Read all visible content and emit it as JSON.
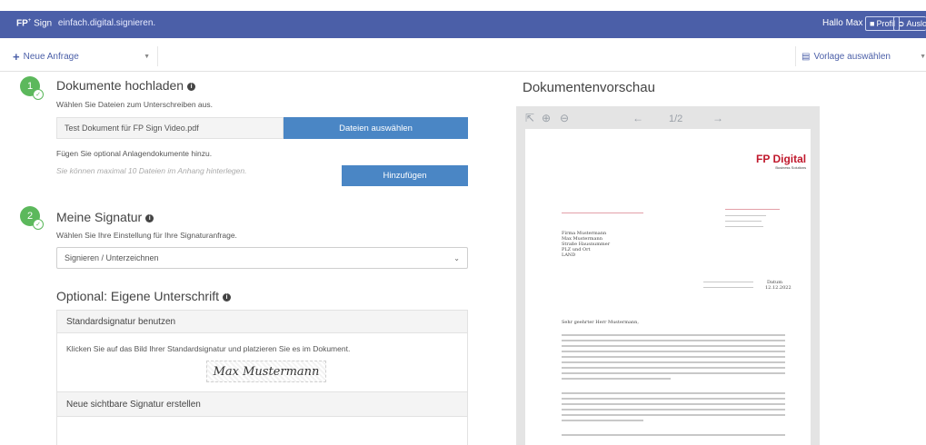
{
  "header": {
    "brand": "FP",
    "brand_suffix": "Sign",
    "tagline": "einfach.digital.signieren.",
    "greeting": "Hallo Max",
    "profile_label": "Profil",
    "logout_label": "Ausloggen"
  },
  "toolbar": {
    "new_request_label": "Neue Anfrage",
    "template_label": "Vorlage auswählen"
  },
  "step1": {
    "number": "1",
    "title": "Dokumente hochladen",
    "subtitle": "Wählen Sie Dateien zum Unterschreiben aus.",
    "file_value": "Test Dokument für FP Sign Video.pdf",
    "choose_files_label": "Dateien auswählen",
    "attachments_hint": "Fügen Sie optional Anlagendokumente hinzu.",
    "attachments_limit": "Sie können maximal 10 Dateien im Anhang hinterlegen.",
    "add_label": "Hinzufügen"
  },
  "step2": {
    "number": "2",
    "title": "Meine Signatur",
    "subtitle": "Wählen Sie Ihre Einstellung für Ihre Signaturanfrage.",
    "select_value": "Signieren / Unterzeichnen"
  },
  "optional": {
    "title": "Optional: Eigene Unterschrift",
    "standard_head": "Standardsignatur benutzen",
    "standard_text": "Klicken Sie auf das Bild Ihrer Standardsignatur und platzieren Sie es im Dokument.",
    "signature_name": "Max Mustermann",
    "new_signature_label": "Neue sichtbare Signatur erstellen"
  },
  "preview": {
    "title": "Dokumentenvorschau",
    "page_indicator": "1/2",
    "doc": {
      "logo": "FP Digital",
      "logo_sub": "Business Solutions",
      "recipient": [
        "Firma Mustermann",
        "Max Mustermann",
        "Straße Hausnummer",
        "PLZ und Ort",
        "LAND"
      ],
      "salutation": "Sehr geehrter Herr Mustermann,",
      "date_label": "Datum",
      "date_value": "12.12.2022"
    }
  }
}
